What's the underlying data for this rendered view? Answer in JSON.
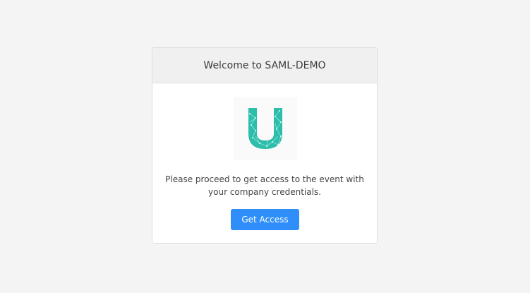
{
  "card": {
    "title": "Welcome to SAML-DEMO",
    "message_line1": "Please proceed to get access to the event with",
    "message_line2": "your company credentials.",
    "button_label": "Get Access"
  },
  "logo": {
    "icon": "u-logo-icon",
    "color": "#2dbdab"
  },
  "colors": {
    "background": "#f4f4f4",
    "button": "#2f8ef9"
  }
}
